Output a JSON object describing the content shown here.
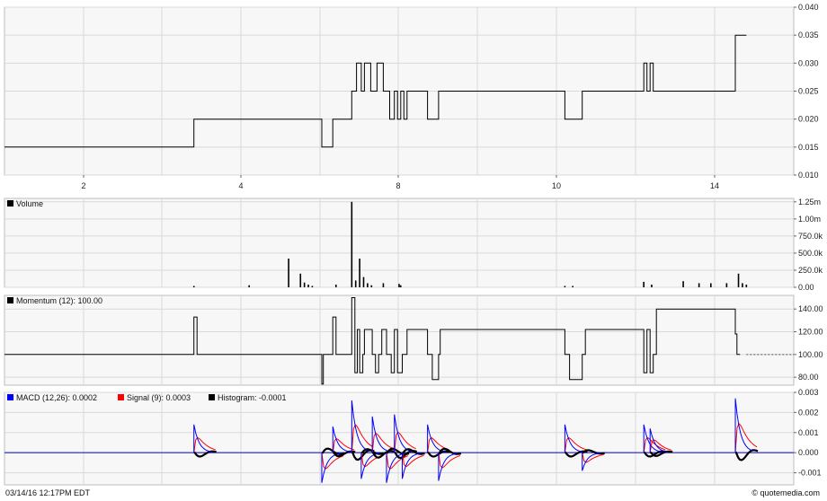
{
  "chart_data": [
    {
      "type": "line",
      "name": "price",
      "x_ticks": [
        "2",
        "4",
        "8",
        "10",
        "14"
      ],
      "y_ticks": [
        "0.040",
        "0.035",
        "0.030",
        "0.025",
        "0.020",
        "0.015",
        "0.010"
      ],
      "ylim": [
        0.01,
        0.04
      ],
      "grid": true,
      "x": [
        0.0,
        0.24,
        0.24,
        0.402,
        0.402,
        0.416,
        0.416,
        0.44,
        0.44,
        0.446,
        0.446,
        0.452,
        0.452,
        0.456,
        0.456,
        0.464,
        0.464,
        0.472,
        0.472,
        0.48,
        0.48,
        0.488,
        0.488,
        0.494,
        0.494,
        0.498,
        0.498,
        0.502,
        0.502,
        0.506,
        0.506,
        0.51,
        0.51,
        0.536,
        0.536,
        0.55,
        0.55,
        0.71,
        0.71,
        0.732,
        0.732,
        0.81,
        0.81,
        0.814,
        0.814,
        0.818,
        0.818,
        0.822,
        0.822,
        0.926,
        0.926,
        0.94
      ],
      "values": [
        0.015,
        0.015,
        0.02,
        0.02,
        0.015,
        0.015,
        0.02,
        0.02,
        0.025,
        0.025,
        0.03,
        0.03,
        0.025,
        0.025,
        0.03,
        0.03,
        0.025,
        0.025,
        0.03,
        0.03,
        0.025,
        0.025,
        0.02,
        0.02,
        0.025,
        0.025,
        0.02,
        0.02,
        0.025,
        0.025,
        0.02,
        0.02,
        0.025,
        0.025,
        0.02,
        0.02,
        0.025,
        0.025,
        0.02,
        0.02,
        0.025,
        0.025,
        0.03,
        0.03,
        0.025,
        0.025,
        0.03,
        0.03,
        0.025,
        0.025,
        0.035,
        0.035
      ]
    },
    {
      "type": "bar",
      "name": "volume",
      "legend": "Volume",
      "y_ticks": [
        "1.25m",
        "1.00m",
        "750.0k",
        "500.0k",
        "250.0k",
        "0.00"
      ],
      "ylim": [
        0,
        1300000
      ],
      "x": [
        0.24,
        0.31,
        0.36,
        0.375,
        0.38,
        0.385,
        0.39,
        0.42,
        0.44,
        0.445,
        0.45,
        0.455,
        0.46,
        0.465,
        0.48,
        0.5,
        0.502,
        0.71,
        0.72,
        0.81,
        0.82,
        0.86,
        0.88,
        0.895,
        0.915,
        0.93,
        0.935,
        0.94
      ],
      "values": [
        20000,
        30000,
        420000,
        200000,
        70000,
        40000,
        20000,
        40000,
        1250000,
        100000,
        420000,
        150000,
        60000,
        30000,
        60000,
        50000,
        30000,
        20000,
        20000,
        80000,
        40000,
        90000,
        60000,
        60000,
        60000,
        200000,
        60000,
        40000
      ]
    },
    {
      "type": "line",
      "name": "momentum",
      "legend": "Momentum (12): 100.00",
      "y_ticks": [
        "140.00",
        "120.00",
        "100.00",
        "80.00"
      ],
      "ylim": [
        73,
        152
      ],
      "x": [
        0.0,
        0.24,
        0.24,
        0.244,
        0.244,
        0.402,
        0.402,
        0.404,
        0.404,
        0.416,
        0.416,
        0.42,
        0.42,
        0.44,
        0.44,
        0.444,
        0.444,
        0.447,
        0.447,
        0.45,
        0.45,
        0.454,
        0.454,
        0.456,
        0.456,
        0.466,
        0.466,
        0.47,
        0.47,
        0.474,
        0.474,
        0.478,
        0.478,
        0.484,
        0.484,
        0.49,
        0.49,
        0.494,
        0.494,
        0.498,
        0.498,
        0.504,
        0.504,
        0.51,
        0.51,
        0.536,
        0.536,
        0.542,
        0.542,
        0.55,
        0.55,
        0.552,
        0.552,
        0.71,
        0.71,
        0.716,
        0.716,
        0.732,
        0.732,
        0.736,
        0.736,
        0.81,
        0.81,
        0.814,
        0.814,
        0.818,
        0.818,
        0.822,
        0.822,
        0.826,
        0.826,
        0.926,
        0.926,
        0.928,
        0.928,
        0.932,
        0.932,
        0.94
      ],
      "values": [
        100,
        100,
        133,
        133,
        100,
        100,
        74,
        74,
        100,
        100,
        133,
        133,
        100,
        100,
        150,
        150,
        84,
        84,
        122,
        122,
        84,
        84,
        100,
        100,
        122,
        122,
        100,
        100,
        84,
        84,
        100,
        100,
        122,
        122,
        100,
        100,
        84,
        84,
        122,
        122,
        84,
        84,
        100,
        100,
        122,
        122,
        100,
        100,
        78,
        78,
        100,
        100,
        122,
        122,
        100,
        100,
        78,
        78,
        100,
        100,
        122,
        122,
        84,
        84,
        122,
        122,
        84,
        84,
        100,
        100,
        140,
        140,
        118,
        118,
        100,
        100
      ]
    },
    {
      "type": "line",
      "name": "macd",
      "legend_items": [
        {
          "label": "MACD (12,26): 0.0002",
          "color": "#0000ff"
        },
        {
          "label": "Signal (9): 0.0003",
          "color": "#ff0000"
        },
        {
          "label": "Histogram: -0.0001",
          "color": "#000000"
        }
      ],
      "y_ticks": [
        "0.003",
        "0.002",
        "0.001",
        "0.000",
        "-0.001"
      ],
      "ylim": [
        -0.0016,
        0.003
      ],
      "spikes": [
        {
          "x": 0.24,
          "amp": 0.0014
        },
        {
          "x": 0.402,
          "amp": -0.0015
        },
        {
          "x": 0.416,
          "amp": 0.0013
        },
        {
          "x": 0.44,
          "amp": 0.0026
        },
        {
          "x": 0.452,
          "amp": -0.0013
        },
        {
          "x": 0.466,
          "amp": 0.0018
        },
        {
          "x": 0.484,
          "amp": -0.0015
        },
        {
          "x": 0.494,
          "amp": 0.0019
        },
        {
          "x": 0.504,
          "amp": -0.0013
        },
        {
          "x": 0.536,
          "amp": 0.0014
        },
        {
          "x": 0.55,
          "amp": -0.0014
        },
        {
          "x": 0.71,
          "amp": 0.0014
        },
        {
          "x": 0.732,
          "amp": -0.0009
        },
        {
          "x": 0.81,
          "amp": 0.0014
        },
        {
          "x": 0.818,
          "amp": 0.0012
        },
        {
          "x": 0.926,
          "amp": 0.0027
        }
      ]
    }
  ],
  "footer": {
    "timestamp": "03/14/16 12:17PM EDT",
    "brand": "© quotemedia.com"
  }
}
